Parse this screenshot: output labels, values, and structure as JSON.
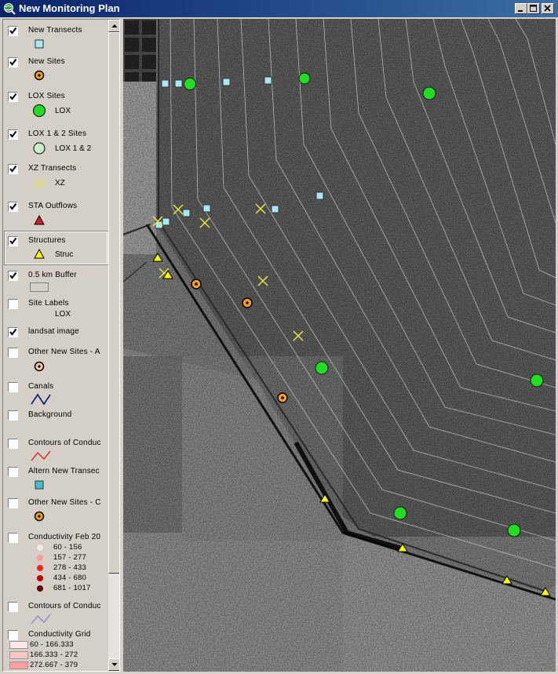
{
  "window": {
    "title": "New Monitoring Plan"
  },
  "toc": {
    "layers": [
      {
        "name": "New Transects",
        "checked": true,
        "legend": [
          {
            "symbol": "square-cyan",
            "label": ""
          }
        ]
      },
      {
        "name": "New Sites",
        "checked": true,
        "legend": [
          {
            "symbol": "circle-orange",
            "label": ""
          }
        ]
      },
      {
        "name": "LOX Sites",
        "checked": true,
        "legend": [
          {
            "symbol": "circle-green",
            "label": "LOX"
          }
        ]
      },
      {
        "name": "LOX 1 & 2 Sites",
        "checked": true,
        "legend": [
          {
            "symbol": "circle-palegreen",
            "label": "LOX 1 & 2"
          }
        ]
      },
      {
        "name": "XZ Transects",
        "checked": true,
        "legend": [
          {
            "symbol": "x-yellow",
            "label": "XZ"
          }
        ]
      },
      {
        "name": "STA Outflows",
        "checked": true,
        "legend": [
          {
            "symbol": "triangle-red",
            "label": ""
          }
        ]
      },
      {
        "name": "Structures",
        "checked": true,
        "legend": [
          {
            "symbol": "triangle-yellow",
            "label": "Struc"
          }
        ]
      },
      {
        "name": "0.5 km Buffer",
        "checked": true,
        "legend": [
          {
            "symbol": "rect-gray",
            "label": ""
          }
        ]
      },
      {
        "name": "Site Labels",
        "checked": false,
        "legend": [
          {
            "symbol": "text",
            "label": "LOX"
          }
        ]
      },
      {
        "name": "landsat image",
        "checked": true,
        "legend": []
      },
      {
        "name": "Other New Sites - A",
        "checked": false,
        "legend": [
          {
            "symbol": "circle-orange",
            "label": ""
          }
        ]
      },
      {
        "name": "Canals",
        "checked": false,
        "legend": [
          {
            "symbol": "line-navy",
            "label": ""
          }
        ]
      },
      {
        "name": "Background",
        "checked": false,
        "legend": []
      },
      {
        "name": "Contours of Conduc",
        "checked": false,
        "legend": [
          {
            "symbol": "line-red",
            "label": ""
          }
        ]
      },
      {
        "name": "Altern New Transec",
        "checked": false,
        "legend": [
          {
            "symbol": "square-teal",
            "label": ""
          }
        ]
      },
      {
        "name": "Other New Sites - C",
        "checked": false,
        "legend": [
          {
            "symbol": "circle-orange",
            "label": ""
          }
        ]
      },
      {
        "name": "Conductivity Feb 20",
        "checked": false,
        "legend": [
          {
            "symbol": "dot-c1",
            "label": "60 - 156"
          },
          {
            "symbol": "dot-c2",
            "label": "157 - 277"
          },
          {
            "symbol": "dot-c3",
            "label": "278 - 433"
          },
          {
            "symbol": "dot-c4",
            "label": "434 - 680"
          },
          {
            "symbol": "dot-c5",
            "label": "681 - 1017"
          }
        ]
      },
      {
        "name": "Contours of Conduc",
        "checked": false,
        "legend": [
          {
            "symbol": "line-lavender",
            "label": ""
          }
        ]
      },
      {
        "name": "Conductivity Grid",
        "checked": false,
        "legend": [
          {
            "symbol": "swatch-g1",
            "label": "60 - 166.333"
          },
          {
            "symbol": "swatch-g2",
            "label": "166.333 - 272"
          },
          {
            "symbol": "swatch-g3",
            "label": "272.667 - 379"
          }
        ]
      }
    ]
  },
  "colors": {
    "title_bar_start": "#0a246a",
    "title_bar_end": "#3a6ea5",
    "transect_square": "#a8e8f4",
    "site_orange": "#f0a020",
    "lox_green": "#22dd22",
    "lox12_green": "#c8f0c8",
    "xz_yellow": "#e8e840",
    "structure_yellow": "#ffff00",
    "sta_red": "#d02020",
    "conductivity": [
      "#ffe6e6",
      "#ff9a9a",
      "#ff2020",
      "#c00000",
      "#600000"
    ],
    "grid": [
      "#ffe8e8",
      "#ffc4c4",
      "#ff9e9e"
    ]
  }
}
